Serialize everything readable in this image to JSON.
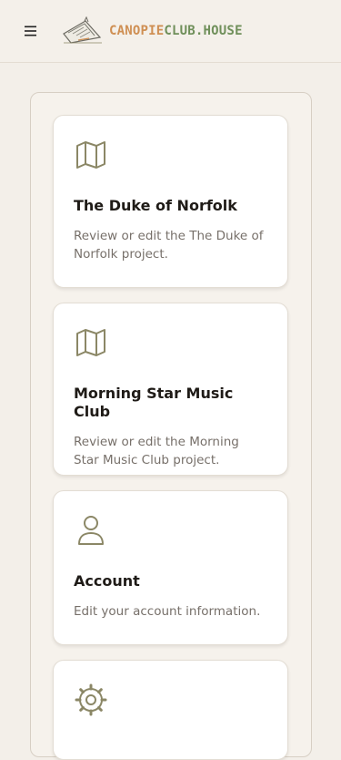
{
  "header": {
    "logo_part1": "CANOPIE",
    "logo_part2": "CLUB.HOUSE"
  },
  "cards": [
    {
      "icon": "map-icon",
      "title": "The Duke of Norfolk",
      "description": "Review or edit the The Duke of Norfolk project."
    },
    {
      "icon": "map-icon",
      "title": "Morning Star Music Club",
      "description": "Review or edit the Morning Star Music Club project."
    },
    {
      "icon": "user-icon",
      "title": "Account",
      "description": "Edit your account information."
    },
    {
      "icon": "gear-icon",
      "title": "",
      "description": ""
    }
  ],
  "colors": {
    "background": "#f3efe9",
    "logo_orange": "#cf8f53",
    "logo_green": "#6f8f5a",
    "icon_olive": "#8b8766"
  }
}
